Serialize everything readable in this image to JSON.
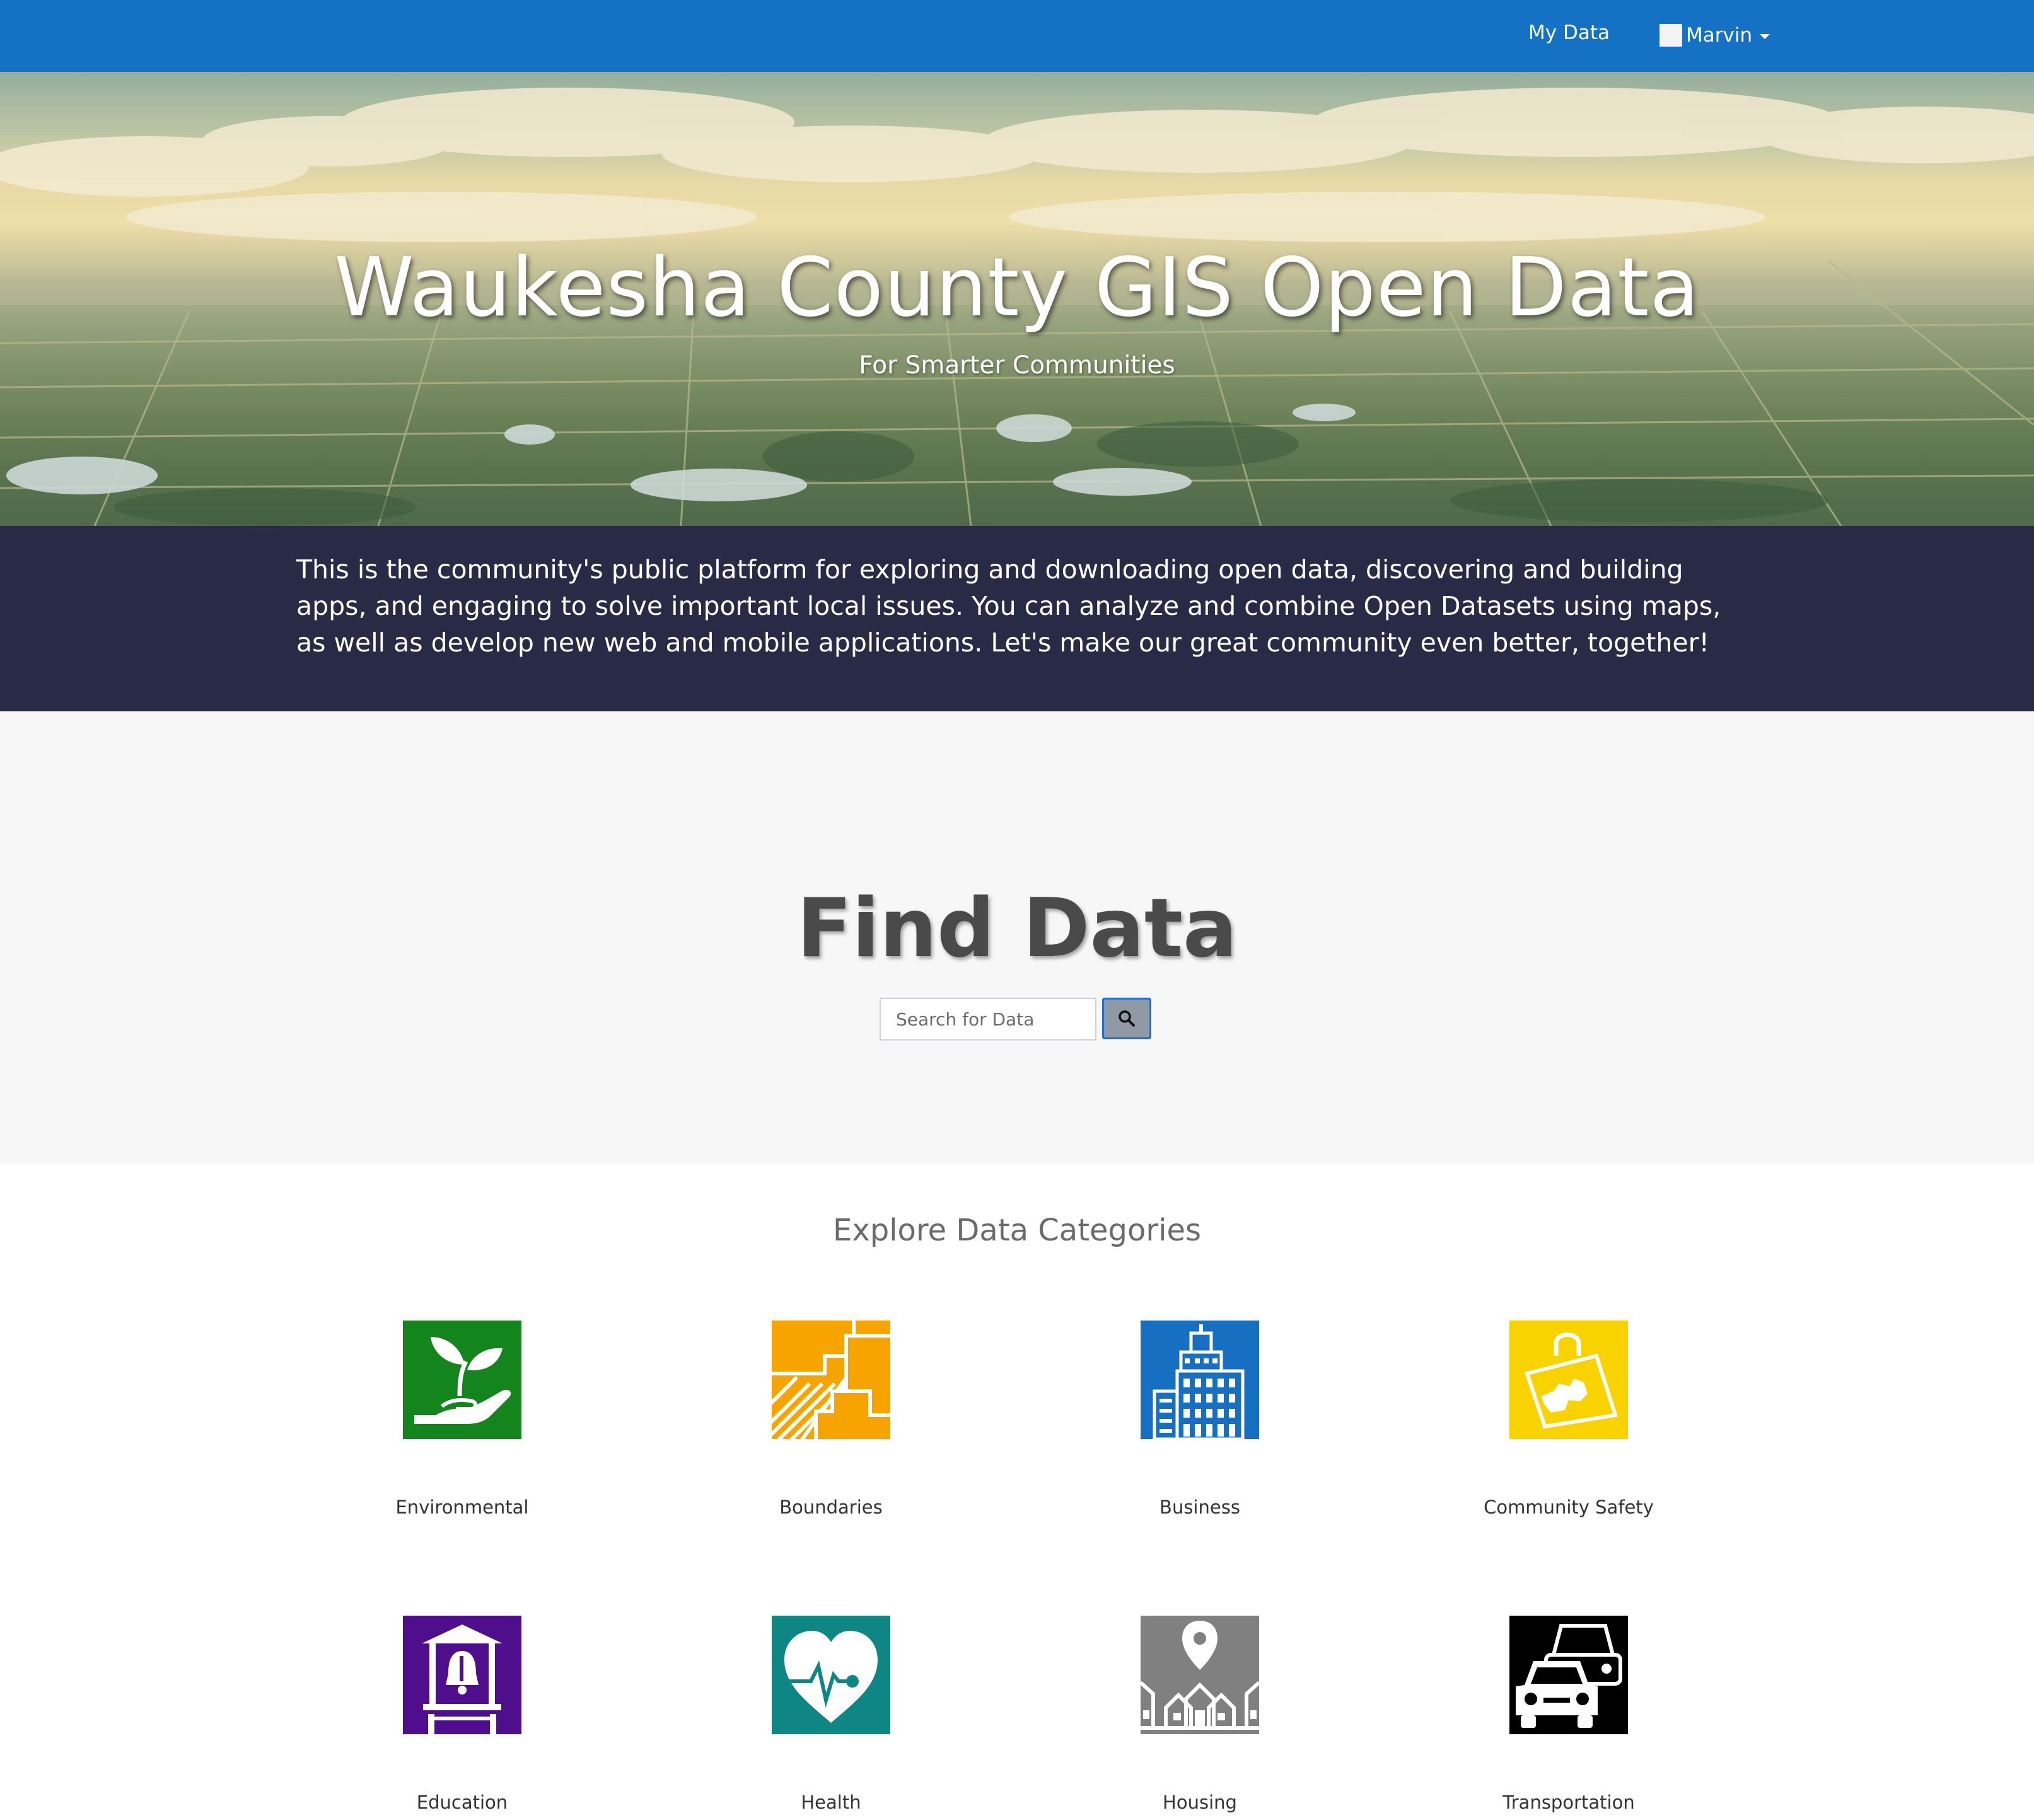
{
  "nav": {
    "my_data": "My Data",
    "user_name": "Marvin"
  },
  "hero": {
    "title": "Waukesha County GIS Open Data",
    "subtitle": "For Smarter Communities"
  },
  "intro": {
    "text": "This is the community's public platform for exploring and downloading open data, discovering and building apps, and engaging to solve important local issues. You can analyze and combine Open Datasets using maps, as well as develop new web and mobile applications. Let's make our great community even better, together!"
  },
  "find": {
    "title": "Find Data",
    "search_placeholder": "Search for Data",
    "search_icon": "search-icon"
  },
  "categories": {
    "title": "Explore Data Categories",
    "items": [
      {
        "label": "Environmental",
        "icon": "plant-in-hand-icon",
        "color": "#14851c"
      },
      {
        "label": "Boundaries",
        "icon": "boundaries-icon",
        "color": "#f7a300"
      },
      {
        "label": "Business",
        "icon": "office-building-icon",
        "color": "#176fc2"
      },
      {
        "label": "Community Safety",
        "icon": "shopping-bag-map-icon",
        "color": "#f8d300"
      },
      {
        "label": "Education",
        "icon": "school-bell-icon",
        "color": "#4f0e8c"
      },
      {
        "label": "Health",
        "icon": "heart-pulse-icon",
        "color": "#0e8683"
      },
      {
        "label": "Housing",
        "icon": "houses-pin-icon",
        "color": "#808080"
      },
      {
        "label": "Transportation",
        "icon": "cars-icon",
        "color": "#000000"
      }
    ]
  }
}
